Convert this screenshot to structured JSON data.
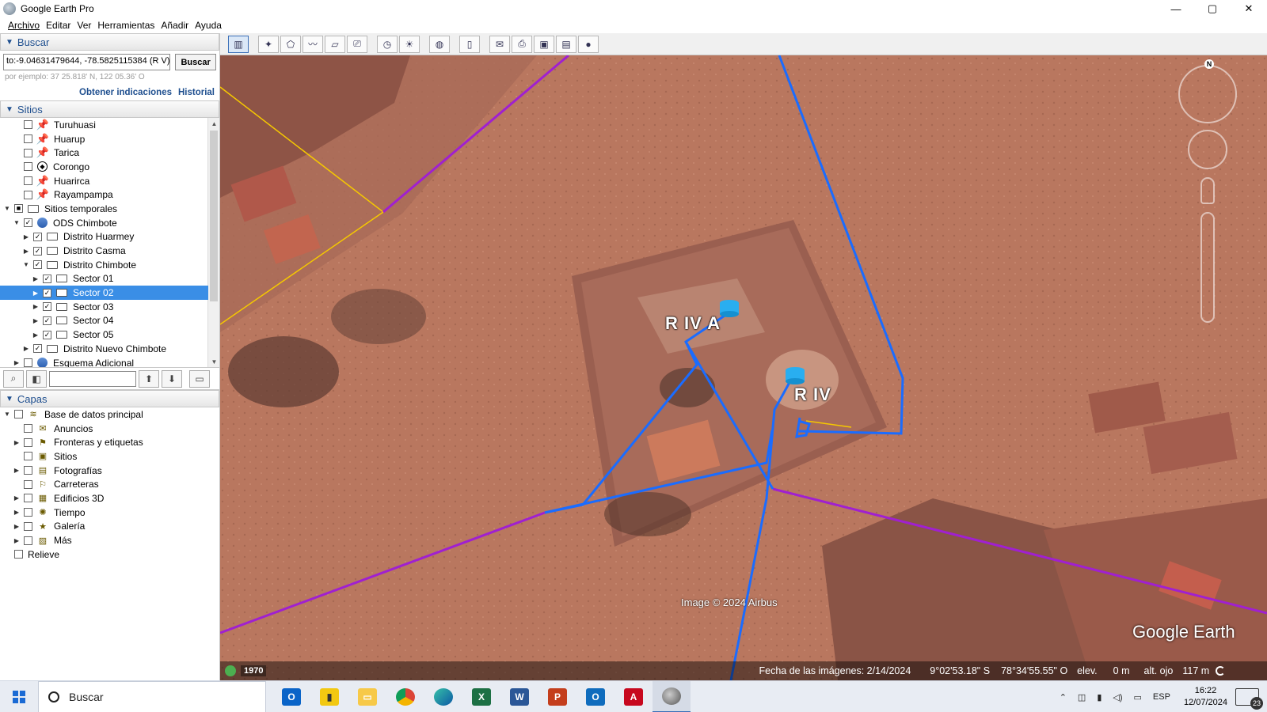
{
  "window": {
    "title": "Google Earth Pro",
    "controls": {
      "minimize": "—",
      "maximize": "▢",
      "close": "✕"
    }
  },
  "menu": [
    "Archivo",
    "Editar",
    "Ver",
    "Herramientas",
    "Añadir",
    "Ayuda"
  ],
  "search_panel": {
    "header": "Buscar",
    "query": "to:-9.04631479644, -78.5825115384 (R V)",
    "button": "Buscar",
    "hint": "por ejemplo: 37 25.818' N, 122 05.36' O",
    "links": [
      "Obtener indicaciones",
      "Historial"
    ]
  },
  "places_panel": {
    "header": "Sitios",
    "items": [
      {
        "label": "Turuhuasi",
        "icon": "yellow-pushpin-icon",
        "checked": false,
        "level": 1,
        "expander": ""
      },
      {
        "label": "Huarup",
        "icon": "yellow-pushpin-icon",
        "checked": false,
        "level": 1,
        "expander": ""
      },
      {
        "label": "Tarica",
        "icon": "yellow-pushpin-icon",
        "checked": false,
        "level": 1,
        "expander": ""
      },
      {
        "label": "Corongo",
        "icon": "target-placemark-icon",
        "checked": false,
        "level": 1,
        "expander": ""
      },
      {
        "label": "Huarirca",
        "icon": "yellow-pushpin-icon",
        "checked": false,
        "level": 1,
        "expander": ""
      },
      {
        "label": "Rayampampa",
        "icon": "yellow-pushpin-icon",
        "checked": false,
        "level": 1,
        "expander": ""
      },
      {
        "label": "Sitios temporales",
        "icon": "open-folder-icon",
        "checked": "partial",
        "level": 0,
        "expander": "▼"
      },
      {
        "label": "ODS Chimbote",
        "icon": "kml-globe-icon",
        "checked": true,
        "level": 1,
        "expander": "▼"
      },
      {
        "label": "Distrito Huarmey",
        "icon": "folder-icon",
        "checked": true,
        "level": 2,
        "expander": "▶"
      },
      {
        "label": "Distrito Casma",
        "icon": "folder-icon",
        "checked": true,
        "level": 2,
        "expander": "▶"
      },
      {
        "label": "Distrito Chimbote",
        "icon": "open-folder-icon",
        "checked": true,
        "level": 2,
        "expander": "▼"
      },
      {
        "label": "Sector 01",
        "icon": "folder-icon",
        "checked": true,
        "level": 3,
        "expander": "▶"
      },
      {
        "label": "Sector 02",
        "icon": "folder-icon",
        "checked": true,
        "level": 3,
        "expander": "▶",
        "selected": true
      },
      {
        "label": "Sector 03",
        "icon": "folder-icon",
        "checked": true,
        "level": 3,
        "expander": "▶"
      },
      {
        "label": "Sector 04",
        "icon": "folder-icon",
        "checked": true,
        "level": 3,
        "expander": "▶"
      },
      {
        "label": "Sector 05",
        "icon": "folder-icon",
        "checked": true,
        "level": 3,
        "expander": "▶"
      },
      {
        "label": "Distrito Nuevo Chimbote",
        "icon": "folder-icon",
        "checked": true,
        "level": 2,
        "expander": "▶"
      },
      {
        "label": "Esquema Adicional",
        "icon": "kml-globe-icon",
        "checked": false,
        "level": 1,
        "expander": "▶"
      }
    ]
  },
  "layers_panel": {
    "header": "Capas",
    "items": [
      {
        "label": "Base de datos principal",
        "icon": "database-layers-icon",
        "level": 0,
        "expander": "▼"
      },
      {
        "label": "Anuncios",
        "icon": "envelope-icon",
        "level": 1,
        "expander": ""
      },
      {
        "label": "Fronteras y etiquetas",
        "icon": "flag-icon",
        "level": 1,
        "expander": "▶"
      },
      {
        "label": "Sitios",
        "icon": "places-icon",
        "level": 1,
        "expander": ""
      },
      {
        "label": "Fotografías",
        "icon": "photo-icon",
        "level": 1,
        "expander": "▶"
      },
      {
        "label": "Carreteras",
        "icon": "road-flag-icon",
        "level": 1,
        "expander": ""
      },
      {
        "label": "Edificios 3D",
        "icon": "buildings-3d-icon",
        "level": 1,
        "expander": "▶"
      },
      {
        "label": "Tiempo",
        "icon": "weather-sun-icon",
        "level": 1,
        "expander": "▶"
      },
      {
        "label": "Galería",
        "icon": "gallery-star-icon",
        "level": 1,
        "expander": "▶"
      },
      {
        "label": "Más",
        "icon": "more-note-icon",
        "level": 1,
        "expander": "▶"
      },
      {
        "label": "Relieve",
        "icon": "",
        "level": 0,
        "expander": ""
      }
    ]
  },
  "map": {
    "labels": [
      "R IV A",
      "R IV"
    ],
    "credit": "Image © 2024 Airbus",
    "logo": "Google Earth",
    "compass_north": "N",
    "status": {
      "historical_year": "1970",
      "imagery_date": "Fecha de las imágenes: 2/14/2024",
      "lat": "9°02'53.18\" S",
      "lon": "78°34'55.55\" O",
      "elev_label": "elev.",
      "elev_value": "0 m",
      "eye_label": "alt. ojo",
      "eye_value": "117 m"
    },
    "colors": {
      "boundary": "#a020d0",
      "pipe": "#1a6cff",
      "road": "#f5c800",
      "ground": "#b8755e"
    }
  },
  "taskbar": {
    "search": "Buscar",
    "apps": [
      "outlook-new-icon",
      "power-bi-icon",
      "file-explorer-icon",
      "chrome-icon",
      "edge-icon",
      "excel-icon",
      "word-icon",
      "powerpoint-icon",
      "outlook-icon",
      "acrobat-icon",
      "google-earth-icon"
    ],
    "lang": "ESP",
    "time": "16:22",
    "date": "12/07/2024",
    "notifications": "23"
  }
}
